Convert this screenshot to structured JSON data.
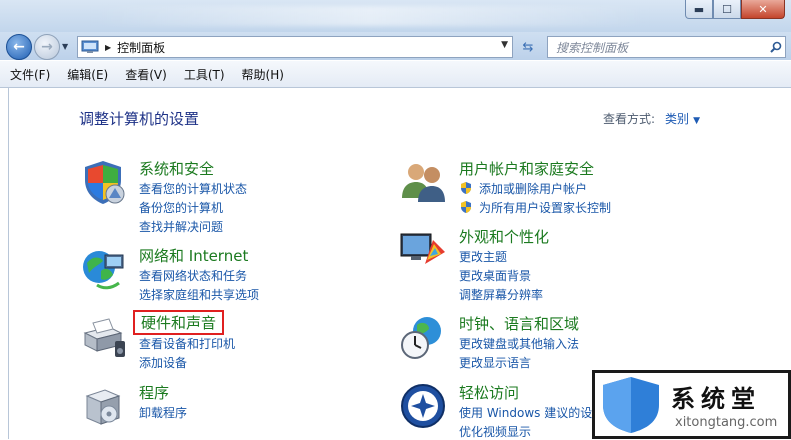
{
  "window": {
    "minimize_label": "▬",
    "maximize_label": "☐",
    "close_label": "✕"
  },
  "address_bar": {
    "path": "控制面板"
  },
  "search": {
    "placeholder": "搜索控制面板"
  },
  "menu": [
    {
      "label": "文件(F)"
    },
    {
      "label": "编辑(E)"
    },
    {
      "label": "查看(V)"
    },
    {
      "label": "工具(T)"
    },
    {
      "label": "帮助(H)"
    }
  ],
  "page": {
    "title": "调整计算机的设置",
    "view_by_label": "查看方式:",
    "view_by_value": "类别"
  },
  "categories": {
    "system": {
      "title": "系统和安全",
      "links": [
        "查看您的计算机状态",
        "备份您的计算机",
        "查找并解决问题"
      ]
    },
    "network": {
      "title": "网络和 Internet",
      "links": [
        "查看网络状态和任务",
        "选择家庭组和共享选项"
      ]
    },
    "hardware": {
      "title": "硬件和声音",
      "links": [
        "查看设备和打印机",
        "添加设备"
      ]
    },
    "programs": {
      "title": "程序",
      "links": [
        "卸载程序"
      ]
    },
    "users": {
      "title": "用户帐户和家庭安全",
      "links": [
        "添加或删除用户帐户",
        "为所有用户设置家长控制"
      ]
    },
    "appearance": {
      "title": "外观和个性化",
      "links": [
        "更改主题",
        "更改桌面背景",
        "调整屏幕分辨率"
      ]
    },
    "clock": {
      "title": "时钟、语言和区域",
      "links": [
        "更改键盘或其他输入法",
        "更改显示语言"
      ]
    },
    "access": {
      "title": "轻松访问",
      "links": [
        "使用 Windows 建议的设置",
        "优化视频显示"
      ]
    }
  },
  "watermark": {
    "brand": "系统堂",
    "url": "xitongtang.com"
  }
}
